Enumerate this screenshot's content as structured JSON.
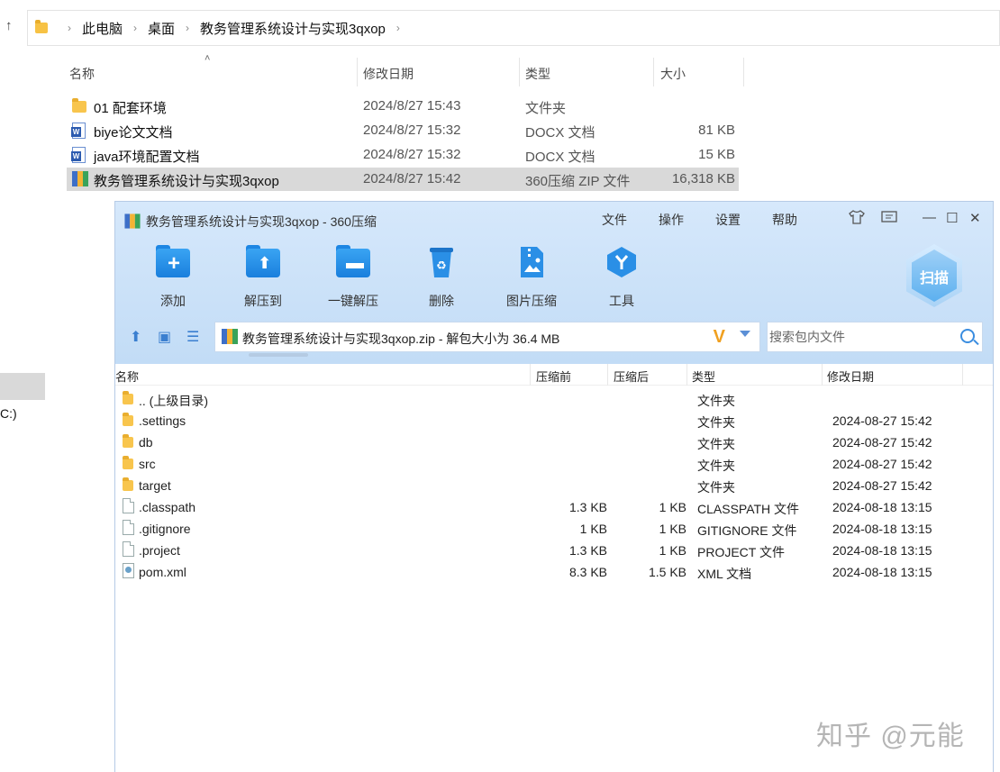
{
  "explorer": {
    "breadcrumbs": [
      "此电脑",
      "桌面",
      "教务管理系统设计与实现3qxop"
    ],
    "left_pane_drive": "C:)",
    "columns": {
      "name": "名称",
      "date": "修改日期",
      "type": "类型",
      "size": "大小"
    },
    "rows": [
      {
        "name": "01 配套环境",
        "date": "2024/8/27 15:43",
        "type": "文件夹",
        "size": "",
        "icon": "folder-icon"
      },
      {
        "name": "biye论文文档",
        "date": "2024/8/27 15:32",
        "type": "DOCX 文档",
        "size": "81 KB",
        "icon": "word-doc-icon"
      },
      {
        "name": "java环境配置文档",
        "date": "2024/8/27 15:32",
        "type": "DOCX 文档",
        "size": "15 KB",
        "icon": "word-doc-icon"
      },
      {
        "name": "教务管理系统设计与实现3qxop",
        "date": "2024/8/27 15:42",
        "type": "360压缩 ZIP 文件",
        "size": "16,318 KB",
        "icon": "zip-archive-icon",
        "selected": true
      }
    ]
  },
  "zip_window": {
    "title": "教务管理系统设计与实现3qxop - 360压缩",
    "menu": [
      "文件",
      "操作",
      "设置",
      "帮助"
    ],
    "toolbar": [
      {
        "label": "添加",
        "icon": "add-icon"
      },
      {
        "label": "解压到",
        "icon": "extract-to-icon"
      },
      {
        "label": "一键解压",
        "icon": "one-click-extract-icon"
      },
      {
        "label": "删除",
        "icon": "delete-icon"
      },
      {
        "label": "图片压缩",
        "icon": "image-compress-icon"
      },
      {
        "label": "工具",
        "icon": "tools-icon"
      }
    ],
    "scan_label": "扫描",
    "path": "教务管理系统设计与实现3qxop.zip - 解包大小为 36.4 MB",
    "search_placeholder": "搜索包内文件",
    "columns": {
      "name": "名称",
      "compressed": "压缩前",
      "decompressed": "压缩后",
      "type": "类型",
      "modified": "修改日期"
    },
    "rows": [
      {
        "name": ".. (上级目录)",
        "before": "",
        "after": "",
        "type": "文件夹",
        "modified": "",
        "icon": "folder-icon"
      },
      {
        "name": ".settings",
        "before": "",
        "after": "",
        "type": "文件夹",
        "modified": "2024-08-27 15:42",
        "icon": "folder-icon"
      },
      {
        "name": "db",
        "before": "",
        "after": "",
        "type": "文件夹",
        "modified": "2024-08-27 15:42",
        "icon": "folder-icon"
      },
      {
        "name": "src",
        "before": "",
        "after": "",
        "type": "文件夹",
        "modified": "2024-08-27 15:42",
        "icon": "folder-icon"
      },
      {
        "name": "target",
        "before": "",
        "after": "",
        "type": "文件夹",
        "modified": "2024-08-27 15:42",
        "icon": "folder-icon"
      },
      {
        "name": ".classpath",
        "before": "1.3 KB",
        "after": "1 KB",
        "type": "CLASSPATH 文件",
        "modified": "2024-08-18 13:15",
        "icon": "file-icon"
      },
      {
        "name": ".gitignore",
        "before": "1 KB",
        "after": "1 KB",
        "type": "GITIGNORE 文件",
        "modified": "2024-08-18 13:15",
        "icon": "file-icon"
      },
      {
        "name": ".project",
        "before": "1.3 KB",
        "after": "1 KB",
        "type": "PROJECT 文件",
        "modified": "2024-08-18 13:15",
        "icon": "file-icon"
      },
      {
        "name": "pom.xml",
        "before": "8.3 KB",
        "after": "1.5 KB",
        "type": "XML 文档",
        "modified": "2024-08-18 13:15",
        "icon": "xml-file-icon"
      }
    ]
  },
  "watermark": "知乎 @元能"
}
